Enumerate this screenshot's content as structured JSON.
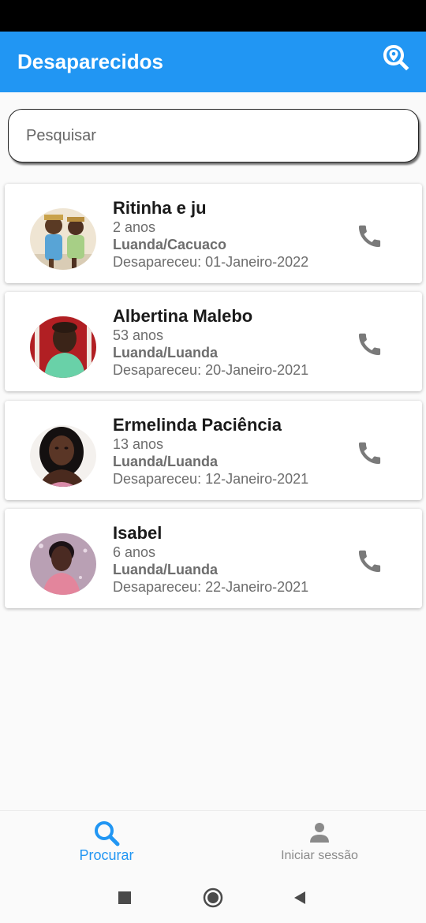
{
  "app_bar": {
    "title": "Desaparecidos",
    "action_icon": "map-search-icon",
    "background": "#2196f3"
  },
  "search": {
    "placeholder": "Pesquisar",
    "value": ""
  },
  "missing_persons": [
    {
      "name": "Ritinha e ju",
      "age": "2 anos",
      "location": "Luanda/Cacuaco",
      "disappeared": "Desapareceu: 01-Janeiro-2022",
      "action_icon": "phone-icon"
    },
    {
      "name": "Albertina Malebo",
      "age": "53 anos",
      "location": "Luanda/Luanda",
      "disappeared": "Desapareceu: 20-Janeiro-2021",
      "action_icon": "phone-icon"
    },
    {
      "name": "Ermelinda Paciência",
      "age": "13 anos",
      "location": "Luanda/Luanda",
      "disappeared": "Desapareceu: 12-Janeiro-2021",
      "action_icon": "phone-icon"
    },
    {
      "name": "Isabel",
      "age": "6 anos",
      "location": "Luanda/Luanda",
      "disappeared": "Desapareceu: 22-Janeiro-2021",
      "action_icon": "phone-icon"
    }
  ],
  "bottom_nav": {
    "items": [
      {
        "label": "Procurar",
        "icon": "search-icon",
        "active": true,
        "color": "#2196f3"
      },
      {
        "label": "Iniciar sessão",
        "icon": "person-icon",
        "active": false,
        "color": "#8a8a8a"
      }
    ]
  },
  "system_nav": {
    "items": [
      "recents-square-icon",
      "home-circle-icon",
      "back-triangle-icon"
    ]
  }
}
